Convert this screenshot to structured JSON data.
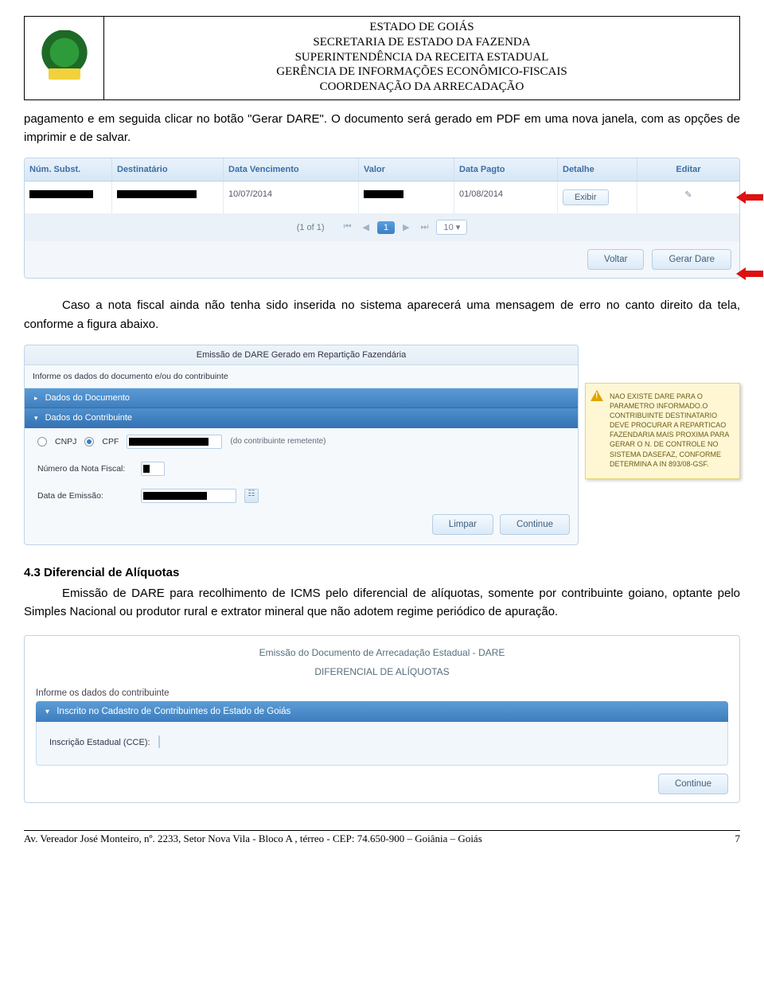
{
  "header": {
    "l1": "ESTADO DE GOIÁS",
    "l2": "SECRETARIA DE ESTADO DA FAZENDA",
    "l3": "SUPERINTENDÊNCIA DA RECEITA ESTADUAL",
    "l4": "GERÊNCIA DE INFORMAÇÕES ECONÔMICO-FISCAIS",
    "l5": "COORDENAÇÃO DA ARRECADAÇÃO"
  },
  "para1": "pagamento e em seguida clicar no botão \"Gerar DARE\". O documento será gerado em PDF em uma nova janela, com as opções de imprimir e de salvar.",
  "shot1": {
    "cols": {
      "num": "Núm. Subst.",
      "dest": "Destinatário",
      "venc": "Data Vencimento",
      "val": "Valor",
      "pagt": "Data Pagto",
      "det": "Detalhe",
      "edit": "Editar"
    },
    "row": {
      "venc": "10/07/2014",
      "pagt": "01/08/2014",
      "exibir": "Exibir"
    },
    "pager": {
      "of": "(1 of 1)",
      "page": "1",
      "sel": "10 ▾"
    },
    "voltar": "Voltar",
    "gerar": "Gerar Dare"
  },
  "para2": "Caso a nota fiscal ainda não tenha sido inserida no sistema aparecerá uma mensagem de erro no canto direito da tela, conforme a figura abaixo.",
  "shot2": {
    "title": "Emissão de DARE Gerado em Repartição Fazendária",
    "sub": "Informe os dados do documento e/ou do contribuinte",
    "acc1": "Dados do Documento",
    "acc2": "Dados do Contribuinte",
    "cnpj": "CNPJ",
    "cpf": "CPF",
    "remetente": "(do contribuinte remetente)",
    "nota": "Número da Nota Fiscal:",
    "data": "Data de Emissão:",
    "limpar": "Limpar",
    "continue": "Continue"
  },
  "warn": "NAO EXISTE DARE PARA O PARAMETRO INFORMADO.O CONTRIBUINTE DESTINATARIO DEVE PROCURAR A REPARTICAO FAZENDARIA MAIS PROXIMA PARA GERAR O N. DE CONTROLE NO SISTEMA DASEFAZ, CONFORME DETERMINA A IN 893/08-GSF.",
  "sec43_title": "4.3 Diferencial de Alíquotas",
  "sec43_body": "Emissão de DARE para recolhimento de ICMS pelo diferencial de alíquotas, somente por contribuinte goiano, optante pelo Simples Nacional ou produtor rural e extrator mineral que não adotem regime periódico de apuração.",
  "shot3": {
    "title1": "Emissão do Documento de Arrecadação Estadual - DARE",
    "title2": "DIFERENCIAL DE ALÍQUOTAS",
    "sub": "Informe os dados do contribuinte",
    "panel": "Inscrito no Cadastro de Contribuintes do Estado de Goiás",
    "label": "Inscrição Estadual (CCE):",
    "continue": "Continue"
  },
  "footer": {
    "addr": "Av. Vereador José Monteiro, nº. 2233, Setor Nova Vila - Bloco A , térreo - CEP: 74.650-900 – Goiânia – Goiás",
    "page": "7"
  }
}
